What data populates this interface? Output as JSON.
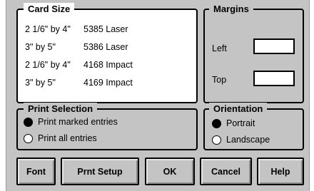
{
  "card_size": {
    "legend": "Card Size",
    "items": [
      {
        "size": "2 1/6\" by 4\"",
        "product": "5385 Laser"
      },
      {
        "size": "3\" by 5\"",
        "product": "5386 Laser"
      },
      {
        "size": "2 1/6\" by 4\"",
        "product": "4168 Impact"
      },
      {
        "size": "3\" by 5\"",
        "product": "4169 Impact"
      }
    ]
  },
  "margins": {
    "legend": "Margins",
    "left_label": "Left",
    "top_label": "Top",
    "left_value": "",
    "top_value": ""
  },
  "print_selection": {
    "legend": "Print Selection",
    "options": [
      {
        "label": "Print marked entries",
        "selected": true
      },
      {
        "label": "Print all entries",
        "selected": false
      }
    ]
  },
  "orientation": {
    "legend": "Orientation",
    "options": [
      {
        "label": "Portrait",
        "selected": true
      },
      {
        "label": "Landscape",
        "selected": false
      }
    ]
  },
  "buttons": {
    "font": "Font",
    "print_setup": "Prnt Setup",
    "ok": "OK",
    "cancel": "Cancel",
    "help": "Help"
  }
}
